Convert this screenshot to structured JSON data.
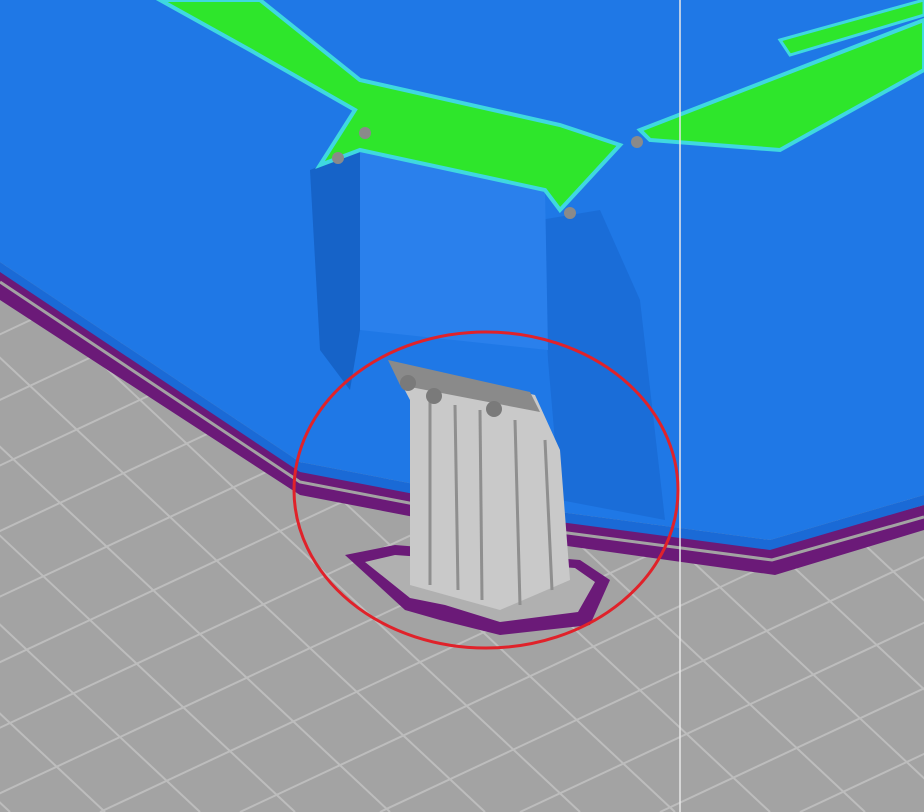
{
  "viewport": {
    "view": "3d-slicer-preview",
    "colors": {
      "bed": "#a3a3a3",
      "bed_grid": "#bdbdbd",
      "perimeter": "#1f78e6",
      "perimeter_shade": "#1663c8",
      "top_infill": "#2ee62b",
      "top_edge": "#3fd8e0",
      "skirt": "#6b1a78",
      "support": "#c9c9c9",
      "support_shade": "#8f8f8f",
      "highlight_circle": "#e0222a",
      "cursor_line": "#e8e8e8"
    }
  }
}
